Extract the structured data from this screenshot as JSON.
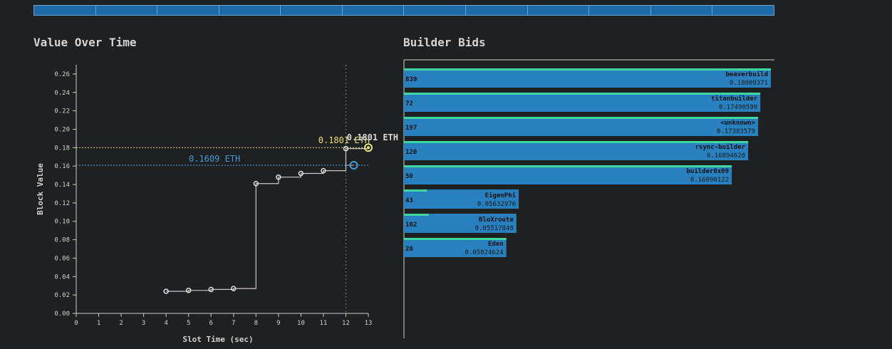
{
  "top_bar": {
    "segments": 12,
    "color": "#1e6aa9"
  },
  "value_chart": {
    "title": "Value Over Time",
    "chart_data": {
      "type": "line",
      "title": "Value Over Time",
      "xlabel": "Slot Time (sec)",
      "ylabel": "Block Value",
      "xlim": [
        0,
        13
      ],
      "ylim": [
        0,
        0.27
      ],
      "xticks": [
        0,
        1,
        2,
        3,
        4,
        5,
        6,
        7,
        8,
        9,
        10,
        11,
        12,
        13
      ],
      "yticks": [
        0.0,
        0.02,
        0.04,
        0.06,
        0.08,
        0.1,
        0.12,
        0.14,
        0.16,
        0.18,
        0.2,
        0.22,
        0.24,
        0.26
      ],
      "series": [
        {
          "step": true,
          "color": "#c8c8c8",
          "points": [
            {
              "x": 4,
              "y": 0.024
            },
            {
              "x": 5,
              "y": 0.025
            },
            {
              "x": 6,
              "y": 0.026
            },
            {
              "x": 7,
              "y": 0.027
            },
            {
              "x": 8,
              "y": 0.141
            },
            {
              "x": 9,
              "y": 0.148
            },
            {
              "x": 10,
              "y": 0.152
            },
            {
              "x": 11,
              "y": 0.155
            },
            {
              "x": 12,
              "y": 0.179
            }
          ]
        }
      ],
      "vline": {
        "x": 12,
        "color": "#777777"
      },
      "reference_lines": [
        {
          "y": 0.1801,
          "color": "#e6e27a",
          "label": "0.1801 ETH",
          "marker_x": 13,
          "point_label": "0.1801 ETH"
        },
        {
          "y": 0.1609,
          "color": "#3f9ad8",
          "label": "0.1609 ETH",
          "marker_x": 12.35
        }
      ]
    }
  },
  "bids_chart": {
    "title": "Builder Bids",
    "chart_data": {
      "type": "bar",
      "title": "Builder Bids",
      "orientation": "horizontal",
      "max_value": 0.18009371,
      "bar_color": "#2880bf",
      "accent_color": "#3fd6a0",
      "bars": [
        {
          "builder": "beaverbuild",
          "count": "839",
          "value": "0.18009371",
          "v": 0.18009371,
          "accent": 1.0
        },
        {
          "builder": "titanbuilder",
          "count": "72",
          "value": "0.17490590",
          "v": 0.1749059,
          "accent": 1.0
        },
        {
          "builder": "<unknown>",
          "count": "197",
          "value": "0.17383579",
          "v": 0.17383579,
          "accent": 1.0
        },
        {
          "builder": "rsync-builder",
          "count": "120",
          "value": "0.16894628",
          "v": 0.16894628,
          "accent": 1.0
        },
        {
          "builder": "builder0x69",
          "count": "50",
          "value": "0.16090122",
          "v": 0.16090122,
          "accent": 1.0
        },
        {
          "builder": "EigenPhi",
          "count": "43",
          "value": "0.05632976",
          "v": 0.05632976,
          "accent": 0.2
        },
        {
          "builder": "BloXroute",
          "count": "102",
          "value": "0.05517848",
          "v": 0.05517848,
          "accent": 0.22
        },
        {
          "builder": "Eden",
          "count": "20",
          "value": "0.05024624",
          "v": 0.05024624,
          "accent": 1.0
        }
      ]
    }
  }
}
